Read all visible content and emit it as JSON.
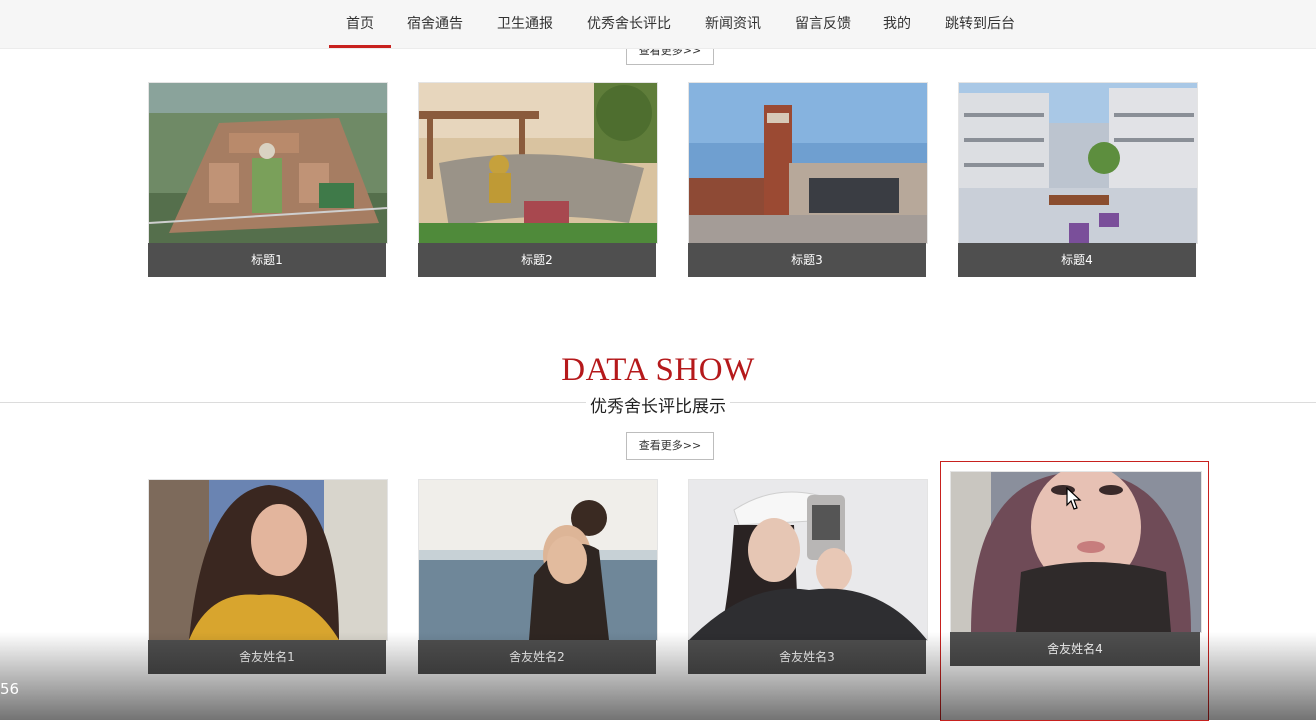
{
  "nav": {
    "items": [
      {
        "label": "首页",
        "active": true
      },
      {
        "label": "宿舍通告"
      },
      {
        "label": "卫生通报"
      },
      {
        "label": "优秀舍长评比"
      },
      {
        "label": "新闻资讯"
      },
      {
        "label": "留言反馈"
      },
      {
        "label": "我的"
      },
      {
        "label": "跳转到后台"
      }
    ]
  },
  "news_section": {
    "more_label": "查看更多>>",
    "cards": [
      {
        "title": "标题1"
      },
      {
        "title": "标题2"
      },
      {
        "title": "标题3"
      },
      {
        "title": "标题4"
      }
    ]
  },
  "data_show": {
    "title": "DATA SHOW",
    "subtitle": "优秀舍长评比展示",
    "more_label": "查看更多>>",
    "cards": [
      {
        "name": "舍友姓名1"
      },
      {
        "name": "舍友姓名2"
      },
      {
        "name": "舍友姓名3"
      },
      {
        "name": "舍友姓名4"
      }
    ]
  },
  "video": {
    "time": "56"
  },
  "colors": {
    "accent": "#c8211e",
    "caption_bg": "#4f4f4f",
    "title_red": "#b5191b"
  }
}
